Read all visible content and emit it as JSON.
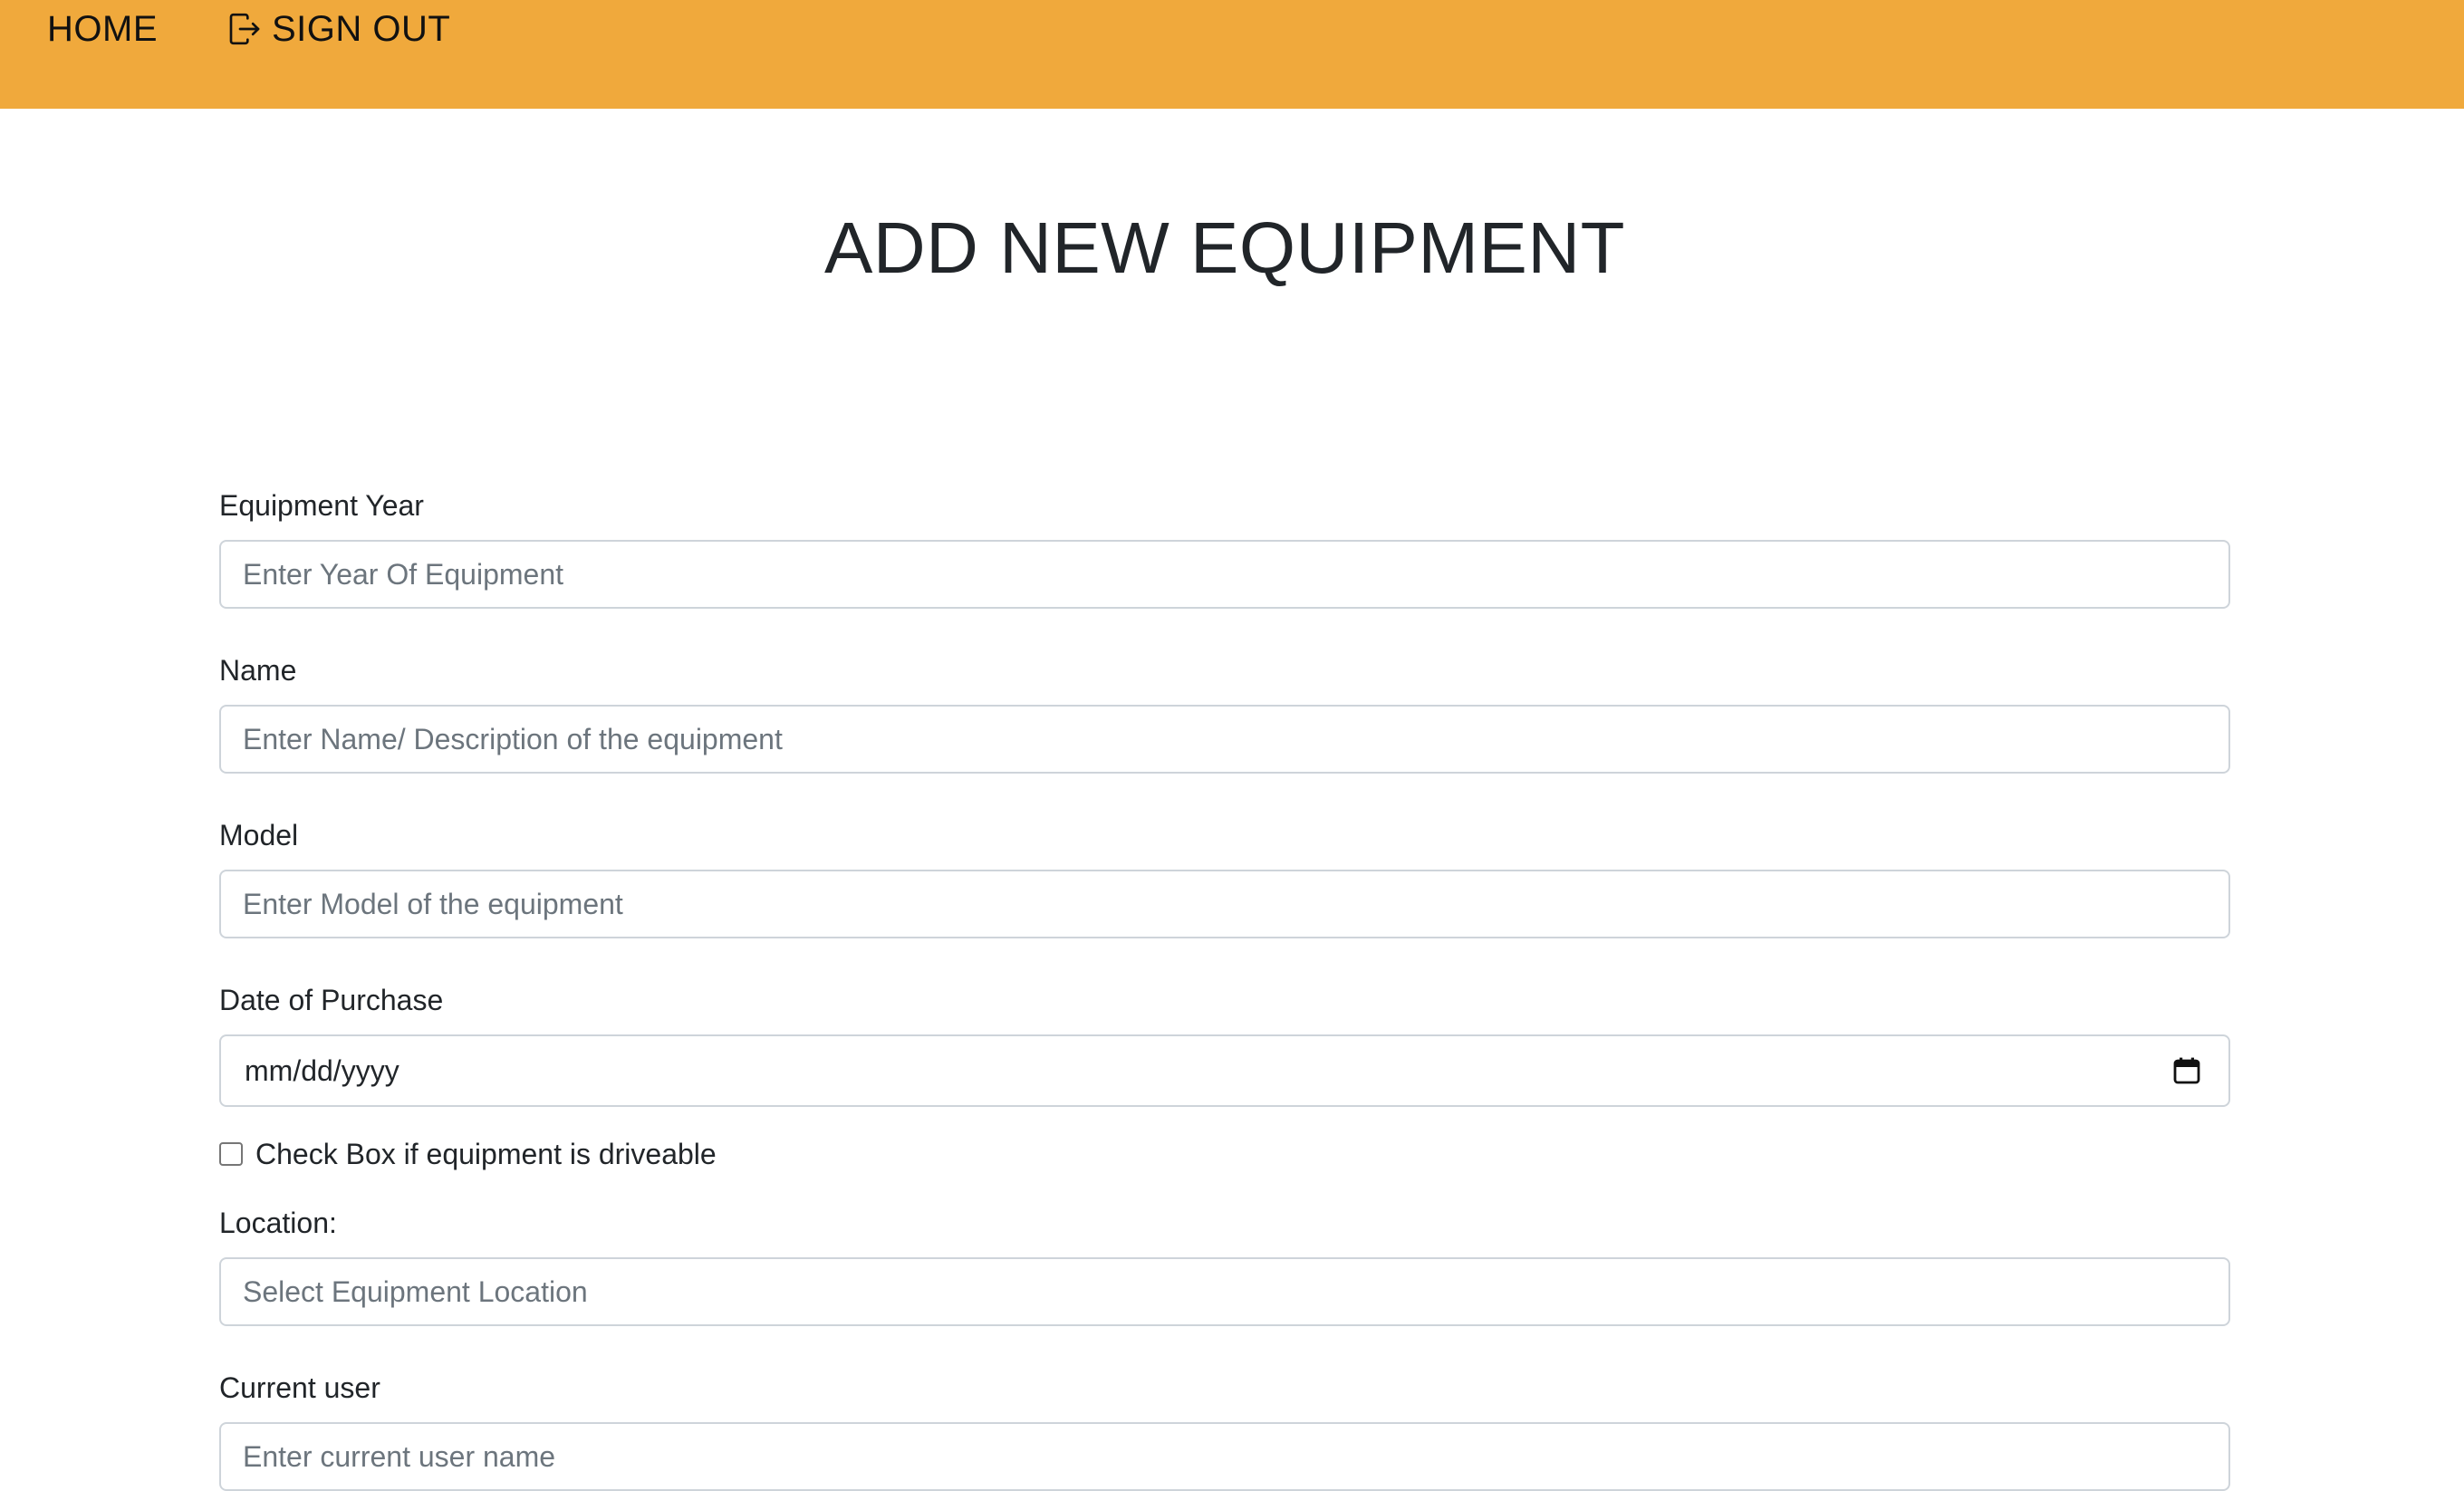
{
  "nav": {
    "home_label": "HOME",
    "signout_label": "SIGN OUT",
    "signout_icon": "sign-out-icon",
    "background": "#f0a93c"
  },
  "page": {
    "title": "ADD NEW EQUIPMENT"
  },
  "form": {
    "year": {
      "label": "Equipment Year",
      "placeholder": "Enter Year Of Equipment",
      "value": ""
    },
    "name": {
      "label": "Name",
      "placeholder": "Enter Name/ Description of the equipment",
      "value": ""
    },
    "model": {
      "label": "Model",
      "placeholder": "Enter Model of the equipment",
      "value": ""
    },
    "purchase_date": {
      "label": "Date of Purchase",
      "value": "mm/dd/yyyy",
      "icon": "calendar-icon"
    },
    "driveable": {
      "label": "Check Box if equipment is driveable",
      "checked": false
    },
    "location": {
      "label": "Location:",
      "placeholder": "Select Equipment Location",
      "value": ""
    },
    "current_user": {
      "label": "Current user",
      "placeholder": "Enter current user name",
      "value": ""
    }
  }
}
